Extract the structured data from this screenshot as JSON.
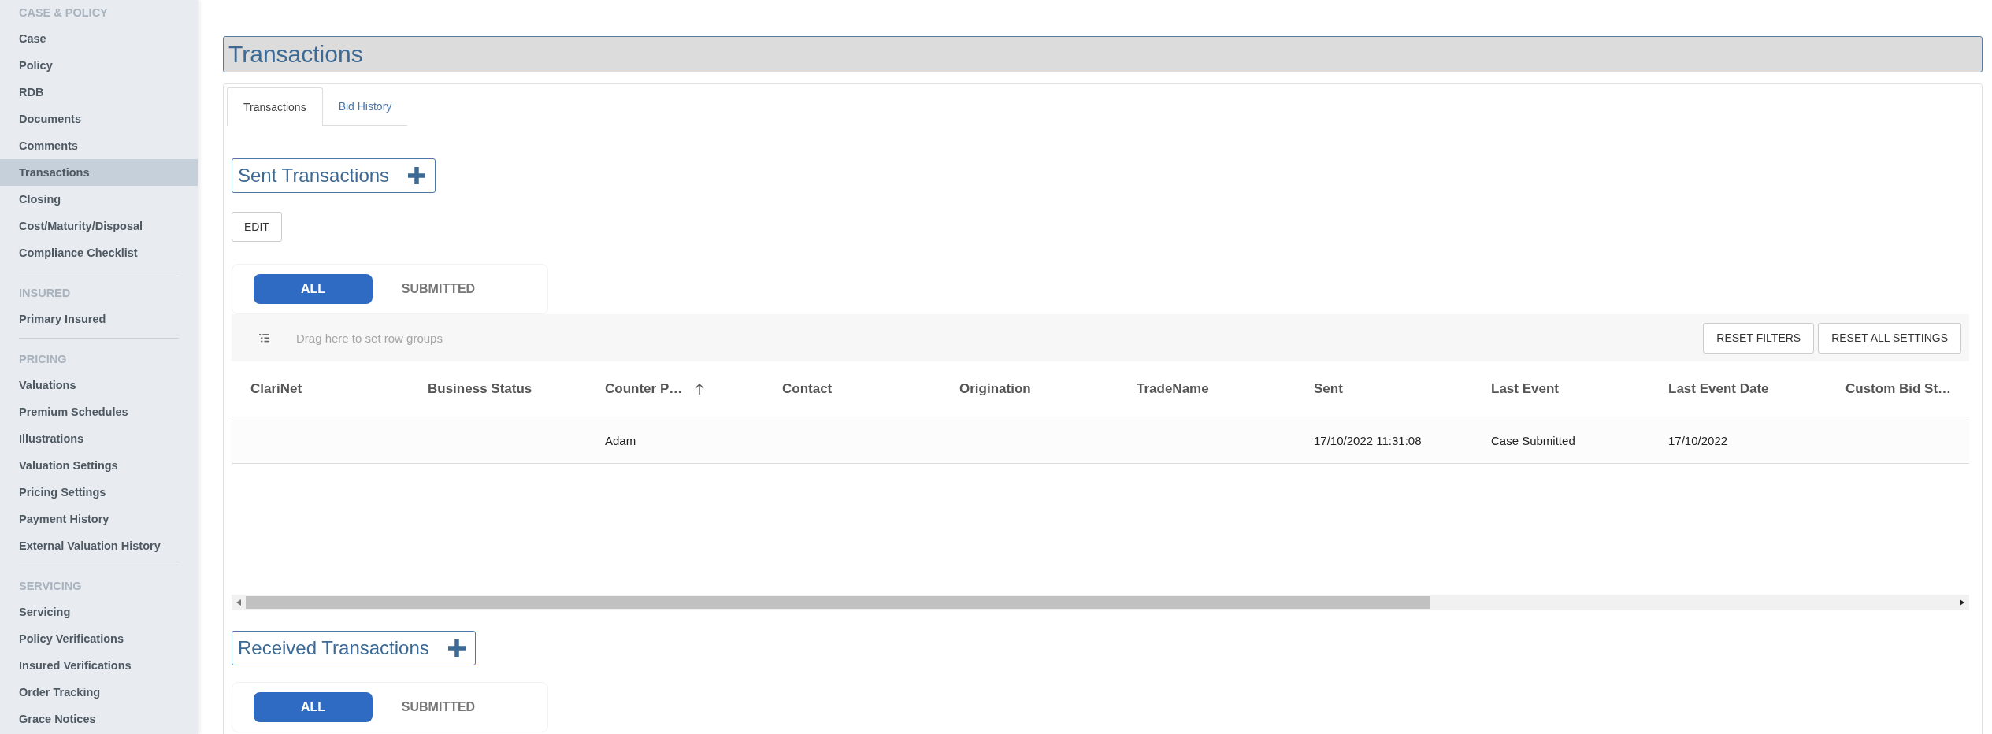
{
  "sidebar": {
    "sections": [
      {
        "heading": "CASE & POLICY",
        "items": [
          {
            "label": "Case",
            "selected": false
          },
          {
            "label": "Policy",
            "selected": false
          },
          {
            "label": "RDB",
            "selected": false
          },
          {
            "label": "Documents",
            "selected": false
          },
          {
            "label": "Comments",
            "selected": false
          },
          {
            "label": "Transactions",
            "selected": true
          },
          {
            "label": "Closing",
            "selected": false
          },
          {
            "label": "Cost/Maturity/Disposal",
            "selected": false
          },
          {
            "label": "Compliance Checklist",
            "selected": false
          }
        ]
      },
      {
        "heading": "INSURED",
        "items": [
          {
            "label": "Primary Insured",
            "selected": false
          }
        ]
      },
      {
        "heading": "PRICING",
        "items": [
          {
            "label": "Valuations",
            "selected": false
          },
          {
            "label": "Premium Schedules",
            "selected": false
          },
          {
            "label": "Illustrations",
            "selected": false
          },
          {
            "label": "Valuation Settings",
            "selected": false
          },
          {
            "label": "Pricing Settings",
            "selected": false
          },
          {
            "label": "Payment History",
            "selected": false
          },
          {
            "label": "External Valuation History",
            "selected": false
          }
        ]
      },
      {
        "heading": "SERVICING",
        "items": [
          {
            "label": "Servicing",
            "selected": false
          },
          {
            "label": "Policy Verifications",
            "selected": false
          },
          {
            "label": "Insured Verifications",
            "selected": false
          },
          {
            "label": "Order Tracking",
            "selected": false
          },
          {
            "label": "Grace Notices",
            "selected": false
          }
        ]
      }
    ]
  },
  "page_title": "Transactions",
  "tabs": [
    {
      "label": "Transactions",
      "selected": true
    },
    {
      "label": "Bid History",
      "selected": false
    }
  ],
  "sections": [
    {
      "title": "Sent Transactions",
      "edit_button": "EDIT",
      "filters": [
        {
          "label": "ALL",
          "selected": true
        },
        {
          "label": "SUBMITTED",
          "selected": false
        }
      ],
      "grid": {
        "group_hint": "Drag here to set row groups",
        "buttons": [
          "RESET FILTERS",
          "RESET ALL SETTINGS"
        ],
        "columns": [
          {
            "label": "ClariNet",
            "sorted": false
          },
          {
            "label": "Business Status",
            "sorted": false
          },
          {
            "label": "Counter P…",
            "sorted": true
          },
          {
            "label": "Contact",
            "sorted": false
          },
          {
            "label": "Origination",
            "sorted": false
          },
          {
            "label": "TradeName",
            "sorted": false
          },
          {
            "label": "Sent",
            "sorted": false
          },
          {
            "label": "Last Event",
            "sorted": false
          },
          {
            "label": "Last Event Date",
            "sorted": false
          },
          {
            "label": "Custom Bid St…",
            "sorted": false
          }
        ],
        "rows": [
          [
            "",
            "",
            "Adam",
            "",
            "",
            "",
            "17/10/2022 11:31:08",
            "Case Submitted",
            "17/10/2022",
            ""
          ]
        ]
      }
    },
    {
      "title": "Received Transactions",
      "filters": [
        {
          "label": "ALL",
          "selected": true
        },
        {
          "label": "SUBMITTED",
          "selected": false
        }
      ]
    }
  ]
}
